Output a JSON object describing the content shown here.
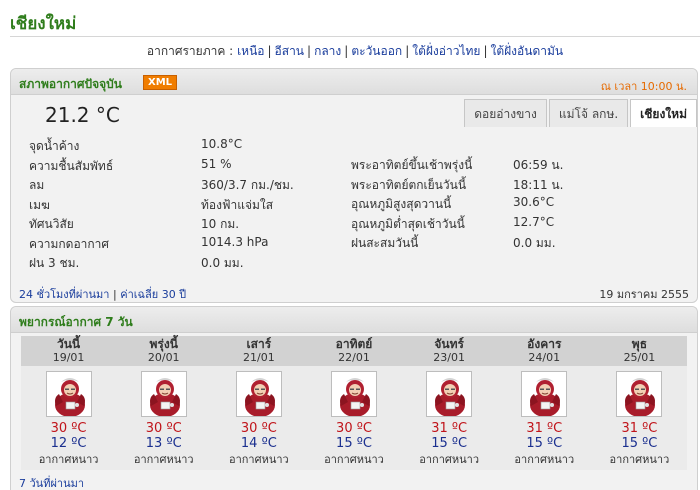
{
  "page": {
    "title": "เชียงใหม่"
  },
  "regions": {
    "label": "อากาศรายภาค :",
    "items": [
      "เหนือ",
      "อีสาน",
      "กลาง",
      "ตะวันออก",
      "ใต้ฝั่งอ่าวไทย",
      "ใต้ฝั่งอันดามัน"
    ]
  },
  "current": {
    "title": "สภาพอากาศปัจจุบัน",
    "xml_badge": "XML",
    "obs_time": "ณ เวลา 10:00 น.",
    "temperature": "21.2 °C",
    "tabs": [
      "ดอยอ่างขาง",
      "แม่โจ้ ลกษ.",
      "เชียงใหม่"
    ],
    "active_tab": 2,
    "left": [
      {
        "label": "จุดน้ำค้าง",
        "value": "10.8°C"
      },
      {
        "label": "ความชื้นสัมพัทธ์",
        "value": "51 %"
      },
      {
        "label": "ลม",
        "value": "360/3.7 กม./ชม."
      },
      {
        "label": "เมฆ",
        "value": "ท้องฟ้าแจ่มใส"
      },
      {
        "label": "ทัศนวิสัย",
        "value": "10 กม."
      },
      {
        "label": "ความกดอากาศ",
        "value": "1014.3 hPa"
      },
      {
        "label": "ฝน 3 ชม.",
        "value": "0.0 มม."
      }
    ],
    "right": [
      {
        "label": "พระอาทิตย์ขึ้นเช้าพรุ่งนี้",
        "value": "06:59 น."
      },
      {
        "label": "พระอาทิตย์ตกเย็นวันนี้",
        "value": "18:11 น."
      },
      {
        "label": "อุณหภูมิสูงสุดวานนี้",
        "value": "30.6°C"
      },
      {
        "label": "อุณหภูมิต่ำสุดเช้าวันนี้",
        "value": "12.7°C"
      },
      {
        "label": "ฝนสะสมวันนี้",
        "value": "0.0 มม."
      }
    ],
    "footer_links": [
      "24 ชั่วโมงที่ผ่านมา",
      "ค่าเฉลี่ย 30 ปี"
    ],
    "date": "19 มกราคม 2555"
  },
  "forecast": {
    "title": "พยากรณ์อากาศ 7 วัน",
    "icon": "cold-weather-person-icon",
    "days": [
      {
        "name": "วันนี้",
        "date": "19/01",
        "high": "30 ºC",
        "low": "12 ºC",
        "desc": "อากาศหนาว"
      },
      {
        "name": "พรุ่งนี้",
        "date": "20/01",
        "high": "30 ºC",
        "low": "13 ºC",
        "desc": "อากาศหนาว"
      },
      {
        "name": "เสาร์",
        "date": "21/01",
        "high": "30 ºC",
        "low": "14 ºC",
        "desc": "อากาศหนาว"
      },
      {
        "name": "อาทิตย์",
        "date": "22/01",
        "high": "30 ºC",
        "low": "15 ºC",
        "desc": "อากาศหนาว"
      },
      {
        "name": "จันทร์",
        "date": "23/01",
        "high": "31 ºC",
        "low": "15 ºC",
        "desc": "อากาศหนาว"
      },
      {
        "name": "อังคาร",
        "date": "24/01",
        "high": "31 ºC",
        "low": "15 ºC",
        "desc": "อากาศหนาว"
      },
      {
        "name": "พุธ",
        "date": "25/01",
        "high": "31 ºC",
        "low": "15 ºC",
        "desc": "อากาศหนาว"
      }
    ],
    "footer_link": "7 วันที่ผ่านมา"
  }
}
